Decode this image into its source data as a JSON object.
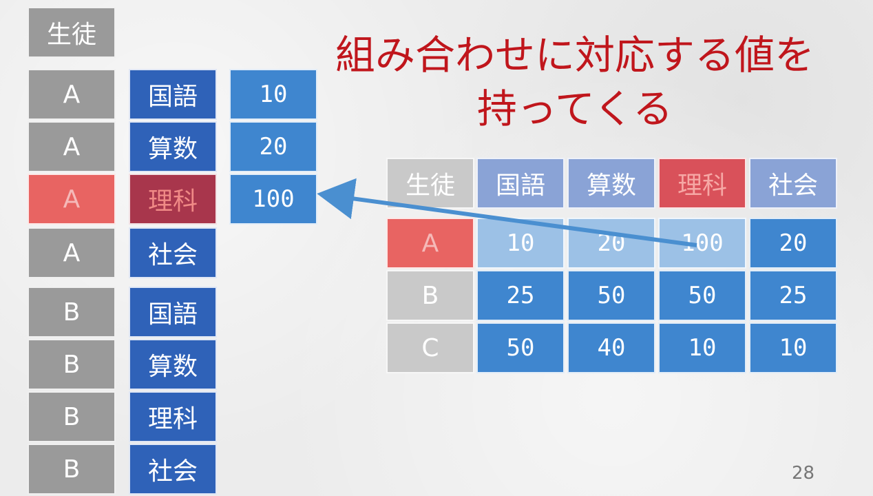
{
  "title": {
    "line1": "組み合わせに対応する値を",
    "line2": "持ってくる"
  },
  "left": {
    "header": "生徒",
    "rows": [
      {
        "student": "A",
        "subject": "国語",
        "value": "10"
      },
      {
        "student": "A",
        "subject": "算数",
        "value": "20"
      },
      {
        "student": "A",
        "subject": "理科",
        "value": "100"
      },
      {
        "student": "A",
        "subject": "社会"
      },
      {
        "student": "B",
        "subject": "国語"
      },
      {
        "student": "B",
        "subject": "算数"
      },
      {
        "student": "B",
        "subject": "理科"
      },
      {
        "student": "B",
        "subject": "社会"
      }
    ]
  },
  "matrix": {
    "headers": [
      "生徒",
      "国語",
      "算数",
      "理科",
      "社会"
    ],
    "rows": [
      {
        "label": "A",
        "values": [
          "10",
          "20",
          "100",
          "20"
        ]
      },
      {
        "label": "B",
        "values": [
          "25",
          "50",
          "50",
          "25"
        ]
      },
      {
        "label": "C",
        "values": [
          "50",
          "40",
          "10",
          "10"
        ]
      }
    ]
  },
  "page_number": "28",
  "colors": {
    "title": "#c0161c",
    "highlight": "#e86462",
    "arrow": "#4a8fd0"
  }
}
